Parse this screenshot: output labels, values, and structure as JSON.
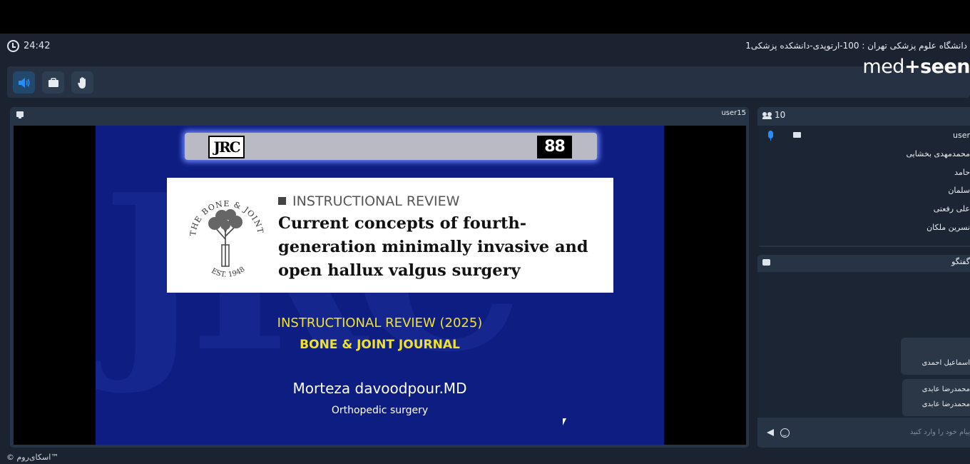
{
  "timer": {
    "value": "24:42"
  },
  "room": {
    "title": "دانشگاه علوم پزشکی تهران : 100-ارتوپدی-دانشکده پزشکی1"
  },
  "brand": {
    "text_a": "med",
    "text_b": "seen"
  },
  "toolbar": {
    "speaker_icon": "speaker-icon",
    "screen_icon": "screen-share-icon",
    "hand_icon": "raise-hand-icon",
    "accent": "#2a8df7"
  },
  "video": {
    "presenter": "user15",
    "slide": {
      "label": "INSTRUCTIONAL REVIEW",
      "title": "Current concepts of fourth-generation minimally invasive and open hallux valgus surgery",
      "seal_text_top": "THE BONE & JOINT JOURNAL",
      "seal_text_bottom": "EST. 1948",
      "jrc": "JRC",
      "review_year": "INSTRUCTIONAL REVIEW (2025)",
      "journal": "BONE & JOINT JOURNAL",
      "author": "Morteza davoodpour.MD",
      "specialty": "Orthopedic surgery"
    }
  },
  "users": {
    "count": "10",
    "list": [
      {
        "name": "user"
      },
      {
        "name": "محمدمهدی بخشایی"
      },
      {
        "name": "حامد"
      },
      {
        "name": "سلمان"
      },
      {
        "name": "علی رفعتی"
      },
      {
        "name": "نسرین ملکان"
      }
    ]
  },
  "chat": {
    "title": "گفتگو",
    "messages": [
      {
        "line1": "",
        "line2": "اسماعیل احمدی"
      },
      {
        "line1": "محمدرضا عابدی",
        "line2": "محمدرضا عابدی"
      }
    ],
    "placeholder": "پیام خود را وارد کنید"
  },
  "footer": {
    "text": "© اسکای‌روم™"
  }
}
